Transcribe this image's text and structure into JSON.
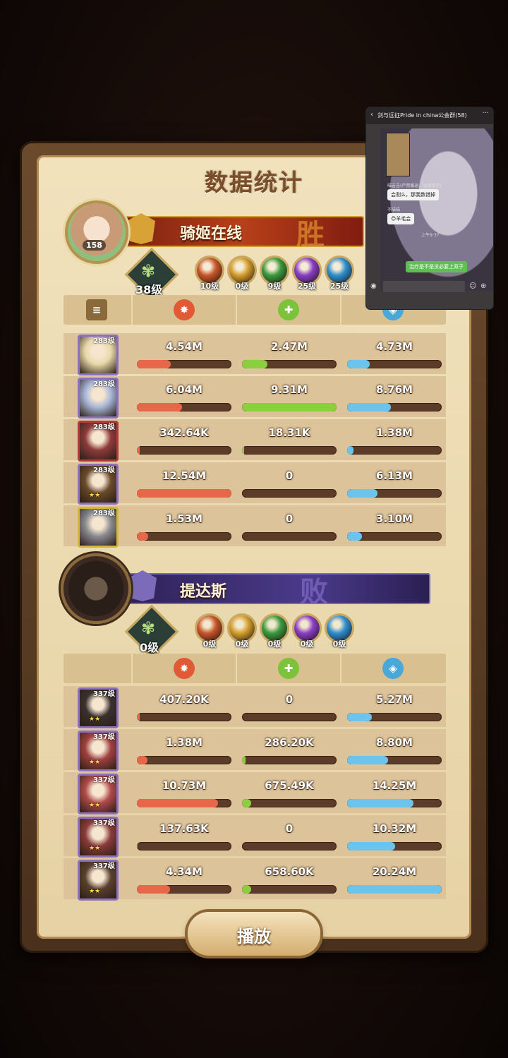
{
  "title": "数据统计",
  "play_label": "播放",
  "win_team": {
    "name": "骑姬在线",
    "result": "胜",
    "avatar_level": "158",
    "tree_level": "38级",
    "orbs": [
      {
        "label": "10级",
        "color": "#c9562a"
      },
      {
        "label": "0级",
        "color": "#d59e2c"
      },
      {
        "label": "9级",
        "color": "#3b9a3e"
      },
      {
        "label": "25级",
        "color": "#8a3ec4"
      },
      {
        "label": "25级",
        "color": "#2f8fcf"
      }
    ],
    "rows": [
      {
        "level": "283级",
        "stars": "",
        "frame": "#8d6fc0",
        "portrait": "#e9d8a8",
        "vals": [
          "4.54M",
          "2.47M",
          "4.73M"
        ],
        "fills": [
          0.36,
          0.27,
          0.24
        ]
      },
      {
        "level": "283级",
        "stars": "",
        "frame": "#8d6fc0",
        "portrait": "#a9b7d8",
        "vals": [
          "6.04M",
          "9.31M",
          "8.76M"
        ],
        "fills": [
          0.48,
          1.0,
          0.46
        ]
      },
      {
        "level": "283级",
        "stars": "",
        "frame": "#b23a3a",
        "portrait": "#8d3a3a",
        "vals": [
          "342.64K",
          "18.31K",
          "1.38M"
        ],
        "fills": [
          0.03,
          0.02,
          0.07
        ]
      },
      {
        "level": "283级",
        "stars": "★★",
        "frame": "#8d6fc0",
        "portrait": "#6a4a2a",
        "vals": [
          "12.54M",
          "0",
          "6.13M"
        ],
        "fills": [
          1.0,
          0,
          0.32
        ]
      },
      {
        "level": "283级",
        "stars": "",
        "frame": "#d6b63a",
        "portrait": "#8a8a90",
        "vals": [
          "1.53M",
          "0",
          "3.10M"
        ],
        "fills": [
          0.12,
          0,
          0.16
        ]
      }
    ]
  },
  "lose_team": {
    "name": "提达斯",
    "result": "败",
    "tree_level": "0级",
    "orbs": [
      {
        "label": "0级",
        "color": "#c9562a"
      },
      {
        "label": "0级",
        "color": "#d59e2c"
      },
      {
        "label": "0级",
        "color": "#3b9a3e"
      },
      {
        "label": "0级",
        "color": "#8a3ec4"
      },
      {
        "label": "0级",
        "color": "#2f8fcf"
      }
    ],
    "rows": [
      {
        "level": "337级",
        "stars": "★★",
        "frame": "#8d6fc0",
        "portrait": "#3a3030",
        "vals": [
          "407.20K",
          "0",
          "5.27M"
        ],
        "fills": [
          0.03,
          0,
          0.26
        ]
      },
      {
        "level": "337级",
        "stars": "★★",
        "frame": "#8d6fc0",
        "portrait": "#a04040",
        "vals": [
          "1.38M",
          "286.20K",
          "8.80M"
        ],
        "fills": [
          0.11,
          0.04,
          0.43
        ]
      },
      {
        "level": "337级",
        "stars": "★★",
        "frame": "#8d6fc0",
        "portrait": "#b04a4a",
        "vals": [
          "10.73M",
          "675.49K",
          "14.25M"
        ],
        "fills": [
          0.86,
          0.1,
          0.7
        ]
      },
      {
        "level": "337级",
        "stars": "★★",
        "frame": "#8d6fc0",
        "portrait": "#8a3a3a",
        "vals": [
          "137.63K",
          "0",
          "10.32M"
        ],
        "fills": [
          0.01,
          0,
          0.51
        ]
      },
      {
        "level": "337级",
        "stars": "★★",
        "frame": "#8d6fc0",
        "portrait": "#5a4030",
        "vals": [
          "4.34M",
          "658.60K",
          "20.24M"
        ],
        "fills": [
          0.35,
          0.1,
          1.0
        ]
      }
    ]
  },
  "bar_colors": [
    "#e8674a",
    "#8bcf3e",
    "#6cc4ec"
  ],
  "overlay": {
    "title": "剑与远征Pride in china公会群(58)",
    "msg1_name": "喵吉吉(严禁撤退、谨慎接单)",
    "msg1": "会割么，那我数错掉",
    "msg2_name": "不喵喵",
    "msg2": "😊羊毛会",
    "time": "上午9:37",
    "msg3": "治疗是不是没必要上双子"
  }
}
